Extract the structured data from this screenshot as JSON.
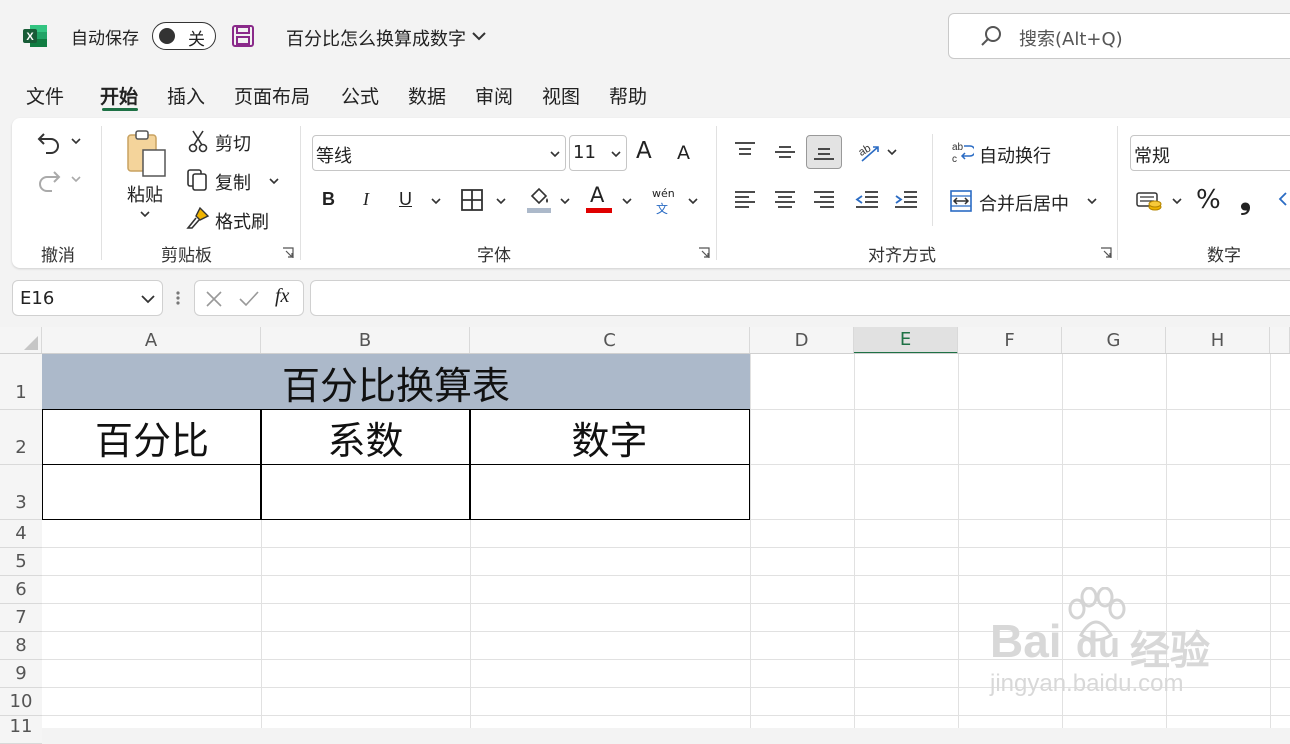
{
  "titlebar": {
    "app_icon": "excel-logo-icon",
    "autosave_label": "自动保存",
    "toggle_label": "关",
    "save_icon": "floppy-save-icon",
    "doc_title": "百分比怎么换算成数字",
    "search_placeholder": "搜索(Alt+Q)"
  },
  "menu": [
    "文件",
    "开始",
    "插入",
    "页面布局",
    "公式",
    "数据",
    "审阅",
    "视图",
    "帮助"
  ],
  "menu_active": "开始",
  "ribbon": {
    "undo_group": "撤消",
    "clipboard": {
      "paste": "粘贴",
      "cut": "剪切",
      "copy": "复制",
      "format_painter": "格式刷",
      "label": "剪贴板"
    },
    "font": {
      "name": "等线",
      "size": "11",
      "grow": "A",
      "shrink": "A",
      "bold": "B",
      "italic": "I",
      "underline": "U",
      "font_color": "A",
      "phonetic_top": "wén",
      "phonetic_bottom": "文",
      "label": "字体"
    },
    "alignment": {
      "wrap": "自动换行",
      "merge": "合并后居中",
      "label": "对齐方式"
    },
    "number": {
      "format": "常规",
      "percent": "%",
      "comma": "❟",
      "label": "数字"
    }
  },
  "formula_bar": {
    "name_box": "E16",
    "fx": "fx",
    "value": ""
  },
  "columns": [
    "A",
    "B",
    "C",
    "D",
    "E",
    "F",
    "G",
    "H"
  ],
  "active_column": "E",
  "rows": [
    "1",
    "2",
    "3",
    "4",
    "5",
    "6",
    "7",
    "8",
    "9",
    "10",
    "11"
  ],
  "sheet": {
    "title": "百分比换算表",
    "headers": [
      "百分比",
      "系数",
      "数字"
    ],
    "row3": [
      "",
      "",
      ""
    ]
  },
  "colors": {
    "accent": "#1e7145",
    "title_fill": "#acb9ca",
    "font_color_bar": "#e00000",
    "save_icon": "#8a2a8a"
  },
  "watermark": {
    "brand": "Bai",
    "brand2": "du",
    "cn": "经验",
    "url": "jingyan.baidu.com"
  }
}
